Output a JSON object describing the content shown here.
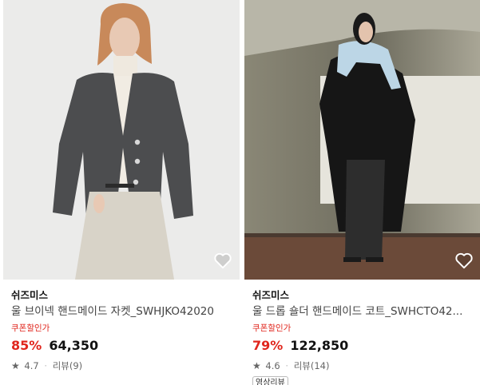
{
  "products": [
    {
      "brand": "쉬즈미스",
      "name": "울 브이넥 핸드메이드 자켓_SWHJKO42020",
      "coupon_label": "쿠폰할인가",
      "discount": "85%",
      "price": "64,350",
      "rating": "4.7",
      "review_label": "리뷰(9)",
      "wishlist_icon": "heart-outline-icon"
    },
    {
      "brand": "쉬즈미스",
      "name": "울 드롭 숄더 핸드메이드 코트_SWHCTO42...",
      "coupon_label": "쿠폰할인가",
      "discount": "79%",
      "price": "122,850",
      "rating": "4.6",
      "review_label": "리뷰(14)",
      "badge": "영상리뷰",
      "wishlist_icon": "heart-outline-icon"
    }
  ],
  "colors": {
    "discount": "#e0261d",
    "coupon": "#e0261d",
    "text_primary": "#111111",
    "text_secondary": "#666666"
  }
}
